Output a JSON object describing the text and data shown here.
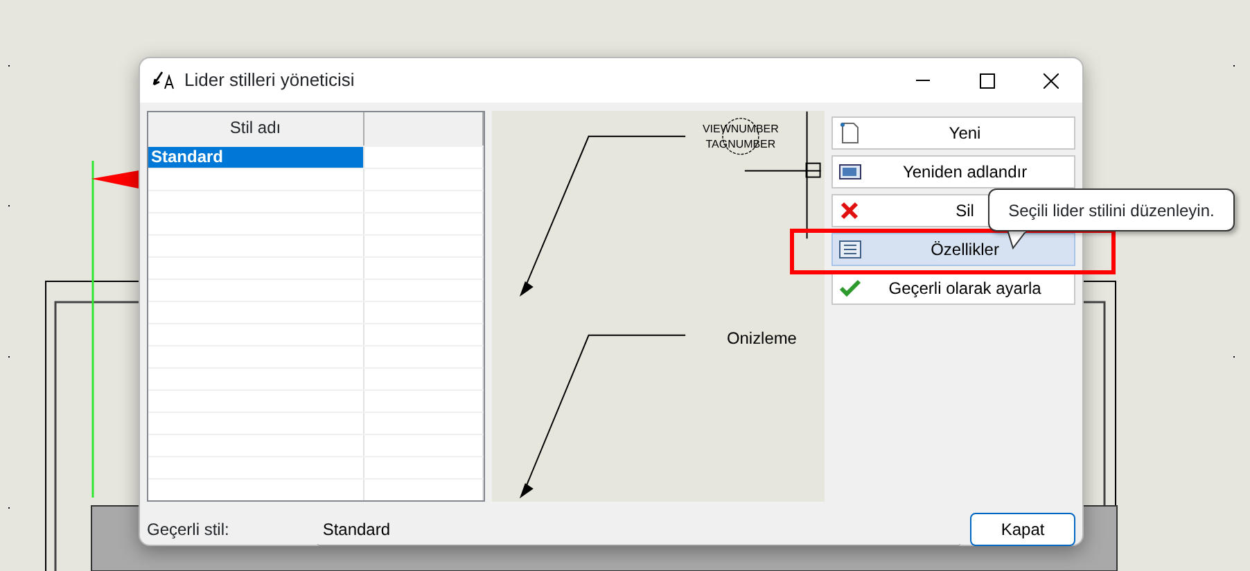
{
  "window": {
    "title": "Lider stilleri yöneticisi"
  },
  "styles_table": {
    "columns": [
      "Stil adı",
      ""
    ],
    "rows": [
      {
        "name": "Standard",
        "selected": true
      }
    ]
  },
  "preview": {
    "top_labels": [
      "VIEWNUMBER",
      "TAGNUMBER"
    ],
    "label": "Onizleme"
  },
  "buttons": [
    {
      "label": "Yeni",
      "kind": "new",
      "hovered": false
    },
    {
      "label": "Yeniden adlandır",
      "kind": "rename",
      "hovered": false
    },
    {
      "label": "Sil",
      "kind": "delete",
      "hovered": false
    },
    {
      "label": "Özellikler",
      "kind": "properties",
      "hovered": true
    },
    {
      "label": "Geçerli olarak ayarla",
      "kind": "set-current",
      "hovered": false
    }
  ],
  "tooltip": {
    "text": "Seçili lider stilini düzenleyin."
  },
  "current_style": {
    "label": "Geçerli stil:",
    "value": "Standard"
  },
  "close_button": {
    "label": "Kapat"
  }
}
